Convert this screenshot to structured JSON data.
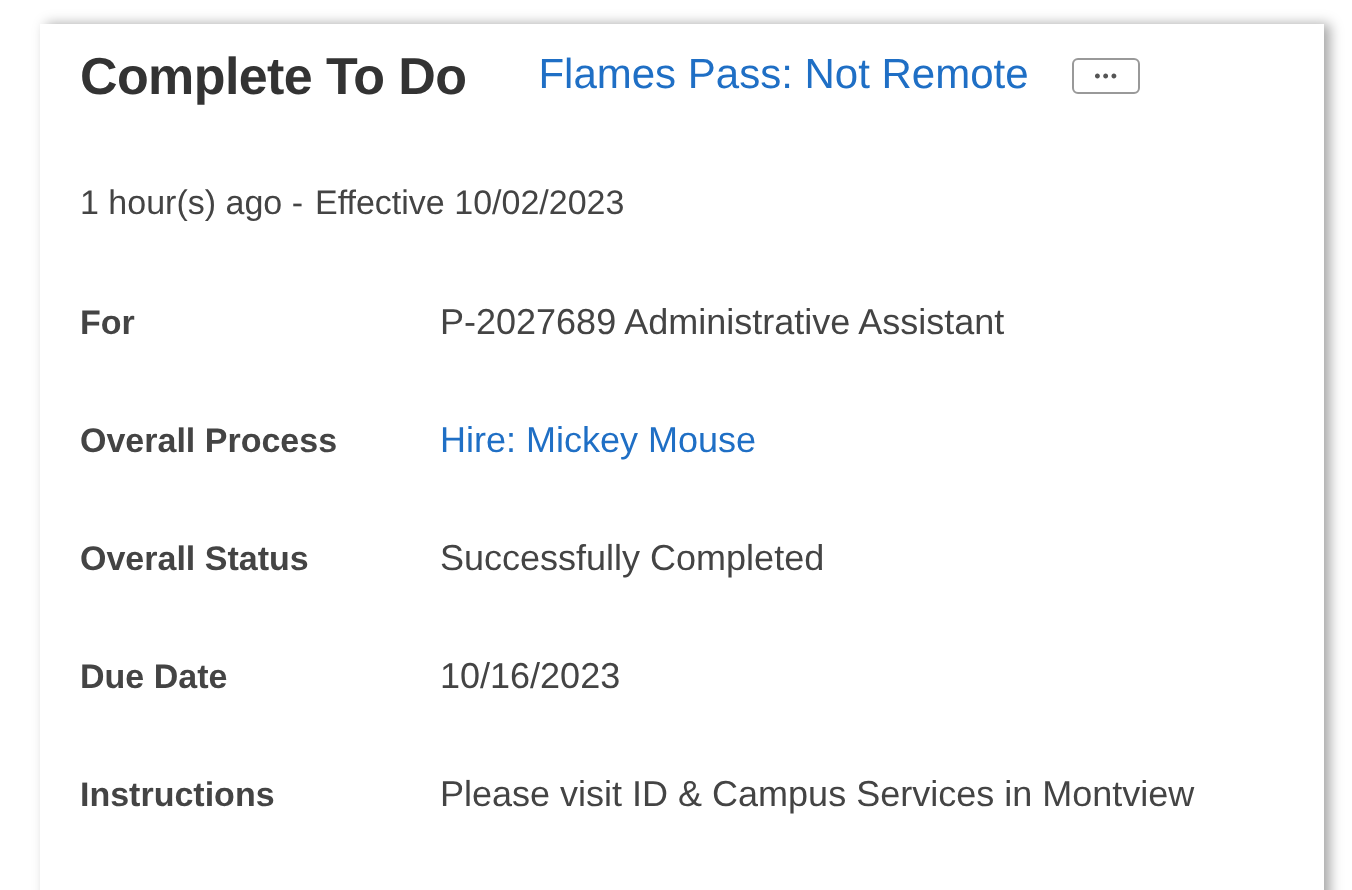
{
  "header": {
    "title": "Complete To Do",
    "subtitle_link": "Flames Pass: Not Remote",
    "more_button": "•••"
  },
  "meta": {
    "age": "1 hour(s) ago -",
    "effective": "Effective 10/02/2023"
  },
  "fields": [
    {
      "label": "For",
      "value": "P-2027689 Administrative Assistant",
      "kind": "text"
    },
    {
      "label": "Overall Process",
      "value": "Hire: Mickey Mouse",
      "kind": "link"
    },
    {
      "label": "Overall Status",
      "value": "Successfully Completed",
      "kind": "text"
    },
    {
      "label": "Due Date",
      "value": "10/16/2023",
      "kind": "text"
    },
    {
      "label": "Instructions",
      "value": "Please visit ID & Campus Services in Montview",
      "kind": "text"
    }
  ]
}
